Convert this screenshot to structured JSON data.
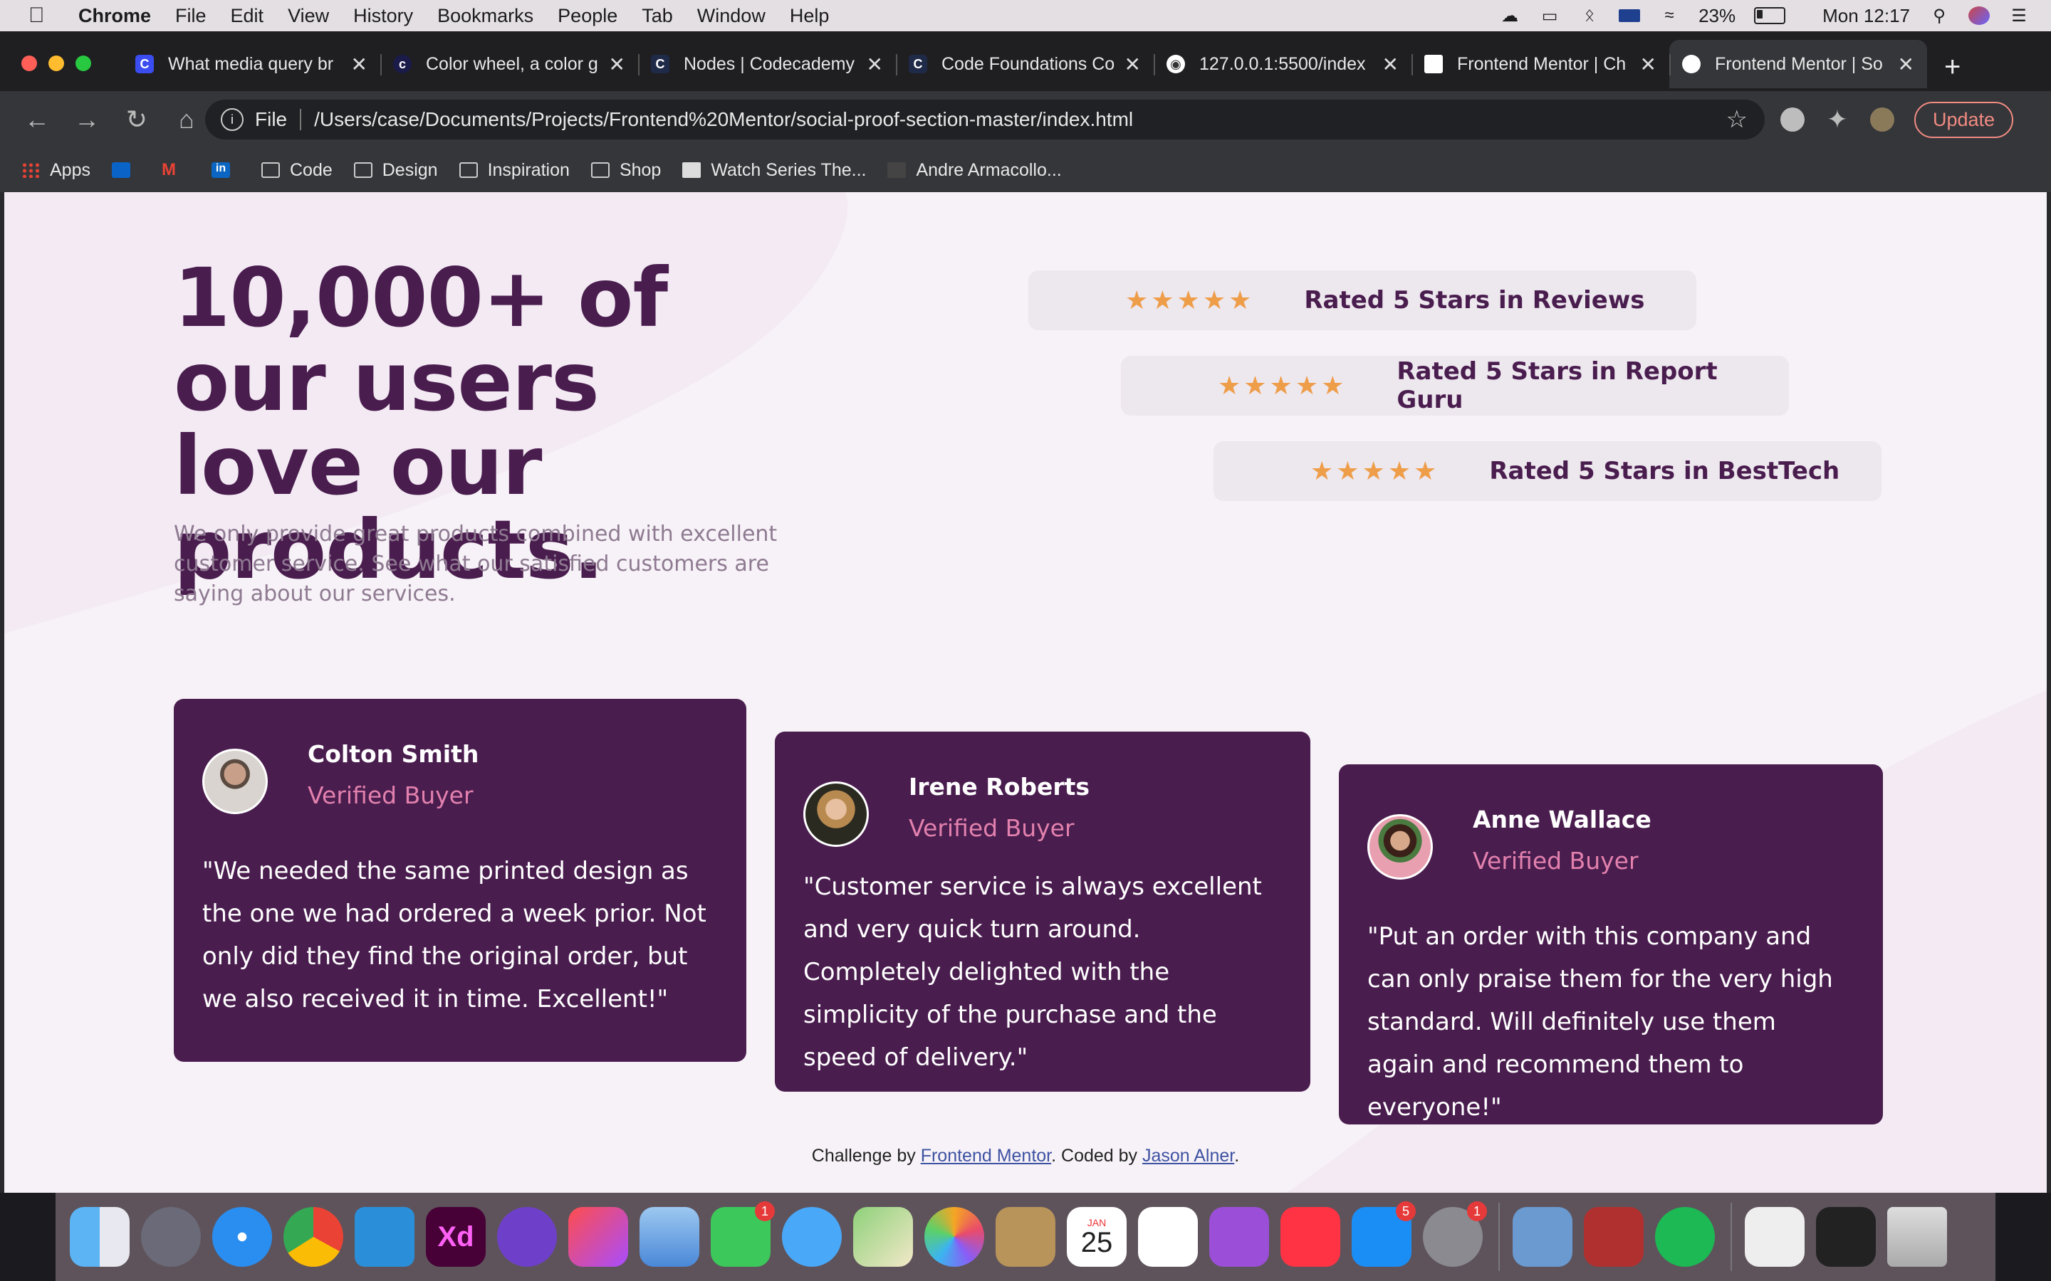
{
  "menubar": {
    "apple": "",
    "app_name": "Chrome",
    "menus": [
      "File",
      "Edit",
      "View",
      "History",
      "Bookmarks",
      "People",
      "Tab",
      "Window",
      "Help"
    ],
    "battery": "23%",
    "clock": "Mon 12:17"
  },
  "browser": {
    "tabs": [
      {
        "title": "What media query br",
        "icon": "C"
      },
      {
        "title": "Color wheel, a color g",
        "icon": "c"
      },
      {
        "title": "Nodes | Codecademy",
        "icon": "C"
      },
      {
        "title": "Code Foundations Co",
        "icon": "C"
      },
      {
        "title": "127.0.0.1:5500/index",
        "icon": "globe"
      },
      {
        "title": "Frontend Mentor | Ch",
        "icon": "fm"
      },
      {
        "title": "Frontend Mentor | So",
        "icon": "fm",
        "active": true
      }
    ],
    "address": {
      "scheme": "File",
      "url": "/Users/case/Documents/Projects/Frontend%20Mentor/social-proof-section-master/index.html"
    },
    "update_label": "Update",
    "bookmarks": [
      "Apps",
      "",
      "",
      "",
      "Code",
      "Design",
      "Inspiration",
      "Shop",
      "Watch Series The...",
      "Andre Armacollo..."
    ]
  },
  "page": {
    "title": "10,000+ of our users love our products.",
    "subtitle": "We only provide great products combined with excellent customer service. See what our satisfied customers are saying about our services.",
    "ratings": [
      {
        "stars": 5,
        "label": "Rated 5 Stars in Reviews"
      },
      {
        "stars": 5,
        "label": "Rated 5 Stars in Report Guru"
      },
      {
        "stars": 5,
        "label": "Rated 5 Stars in BestTech"
      }
    ],
    "testimonials": [
      {
        "name": "Colton Smith",
        "role": "Verified Buyer",
        "quote": "\"We needed the same printed design as the one we had ordered a week prior. Not only did they find the original order, but we also received it in time. Excellent!\""
      },
      {
        "name": "Irene Roberts",
        "role": "Verified Buyer",
        "quote": "\"Customer service is always excellent and very quick turn around. Completely delighted with the simplicity of the purchase and the speed of delivery.\""
      },
      {
        "name": "Anne Wallace",
        "role": "Verified Buyer",
        "quote": "\"Put an order with this company and can only praise them for the very high standard. Will definitely use them again and recommend them to everyone!\""
      }
    ],
    "attribution": {
      "prefix": "Challenge by ",
      "link1": "Frontend Mentor",
      "middle": ". Coded by ",
      "link2": "Jason Alner",
      "suffix": "."
    },
    "colors": {
      "primary": "#4a1d4f",
      "accent_pink": "#e281ad",
      "star_orange": "#ee9d49",
      "background": "#f7f2f7"
    }
  },
  "dock": {
    "calendar_month": "JAN",
    "calendar_day": "25",
    "badges": {
      "messages": "1",
      "appstore": "5",
      "settings": "1"
    }
  }
}
